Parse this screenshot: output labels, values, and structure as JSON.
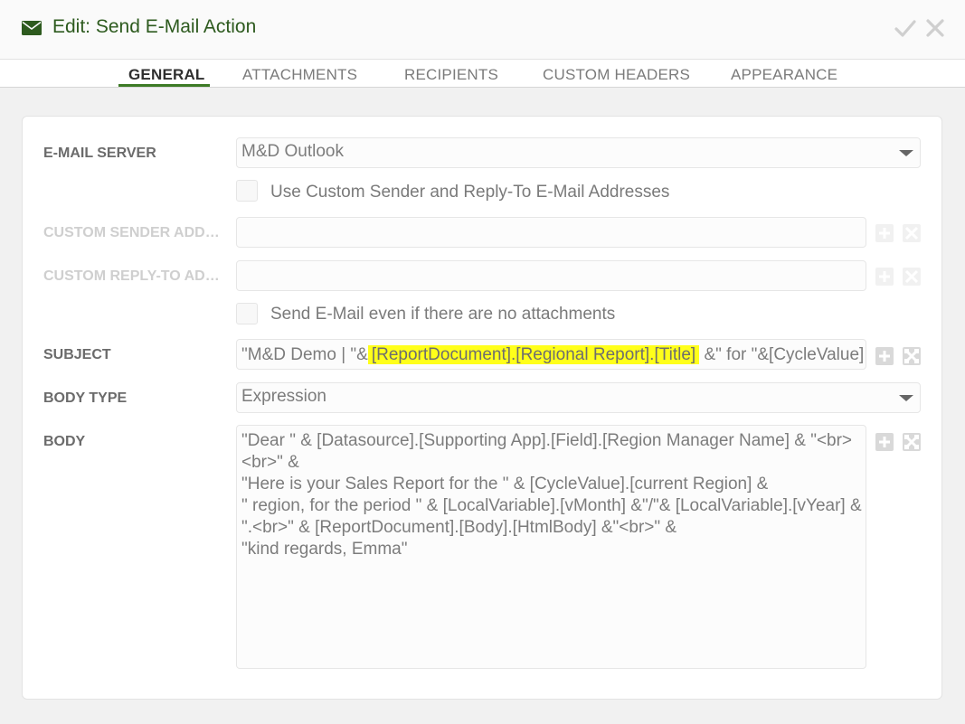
{
  "header": {
    "title": "Edit: Send E-Mail Action",
    "icon": "envelope-icon",
    "confirm_icon": "checkmark-icon",
    "close_icon": "close-icon"
  },
  "tabs": [
    {
      "label": "GENERAL",
      "active": true
    },
    {
      "label": "ATTACHMENTS",
      "active": false
    },
    {
      "label": "RECIPIENTS",
      "active": false
    },
    {
      "label": "CUSTOM HEADERS",
      "active": false
    },
    {
      "label": "APPEARANCE",
      "active": false
    }
  ],
  "form": {
    "email_server": {
      "label": "E-MAIL SERVER",
      "value": "M&D Outlook"
    },
    "use_custom_sender": {
      "label": "Use Custom Sender and Reply-To E-Mail Addresses",
      "checked": false
    },
    "custom_sender": {
      "label": "CUSTOM SENDER ADDRESS",
      "value": ""
    },
    "custom_reply_to": {
      "label": "CUSTOM REPLY-TO ADDRESS",
      "value": ""
    },
    "send_without_attachments": {
      "label": "Send E-Mail even if there are no attachments",
      "checked": false
    },
    "subject": {
      "label": "SUBJECT",
      "prefix": "\"M&D Demo | \"&",
      "highlighted": "[ReportDocument].[Regional Report].[Title]",
      "suffix": " &\" for \"&[CycleValue].[current Region]"
    },
    "body_type": {
      "label": "BODY TYPE",
      "value": "Expression"
    },
    "body": {
      "label": "BODY",
      "value": "\"Dear \" & [Datasource].[Supporting App].[Field].[Region Manager Name] & \"<br><br>\" &\n\"Here is your Sales Report for the \" & [CycleValue].[current Region] &\n\" region, for the period \" & [LocalVariable].[vMonth] &\"/\"& [LocalVariable].[vYear] &\n\".<br>\" & [ReportDocument].[Body].[HtmlBody] &\"<br>\" &\n\"kind regards, Emma\""
    }
  },
  "colors": {
    "accent_green": "#2d5a1e",
    "tab_underline": "#3d7a26",
    "highlight": "#ffff1a"
  }
}
